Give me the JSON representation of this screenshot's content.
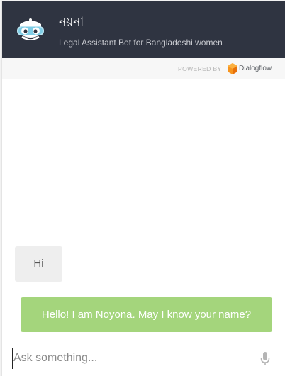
{
  "header": {
    "bot_name": "নয়না",
    "subtitle": "Legal Assistant Bot for Bangladeshi women",
    "avatar_icon": "robot-avatar-icon"
  },
  "powered_by": {
    "label": "POWERED BY",
    "brand": "Dialogflow",
    "logo_icon": "dialogflow-logo-icon",
    "logo_color": "#f7941d"
  },
  "messages": [
    {
      "sender": "user",
      "text": "Hi"
    },
    {
      "sender": "bot",
      "text": "Hello! I am Noyona. May I know your name?"
    }
  ],
  "input": {
    "placeholder": "Ask something...",
    "value": "",
    "mic_icon": "microphone-icon"
  },
  "colors": {
    "header_bg": "#2f3441",
    "bot_bubble": "#a4d57c",
    "user_bubble": "#eeeeee"
  }
}
